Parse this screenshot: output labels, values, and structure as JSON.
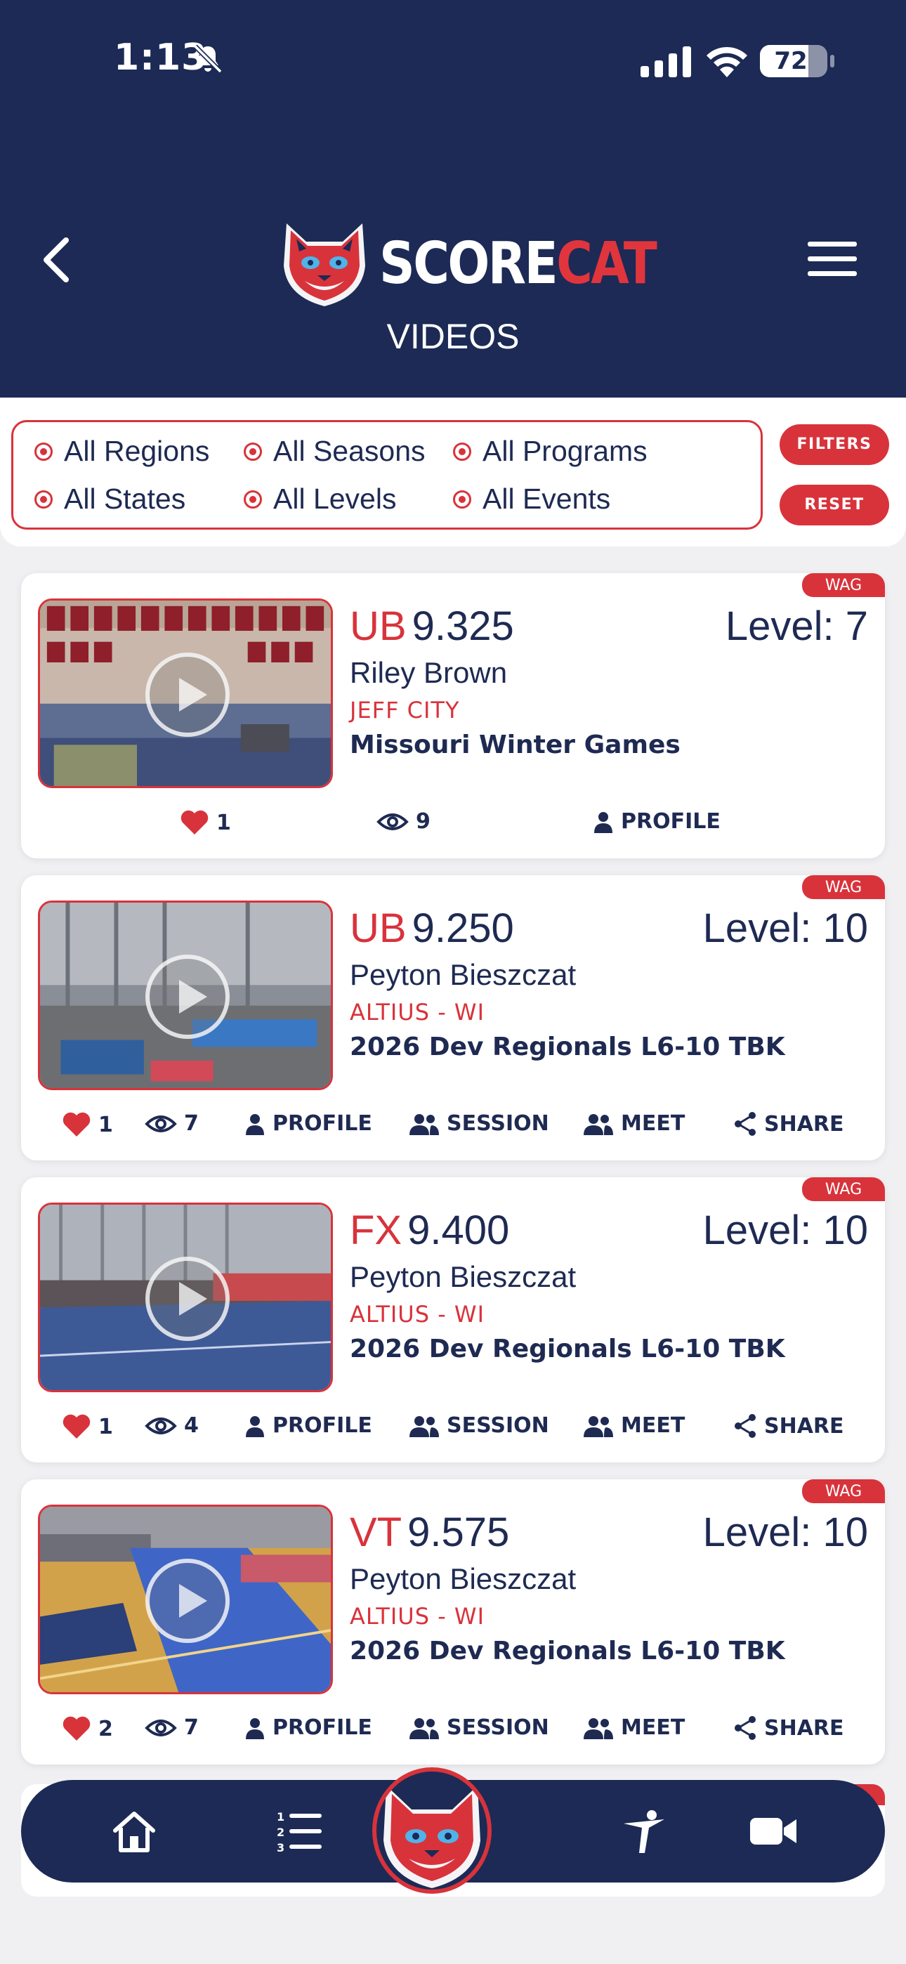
{
  "status_bar": {
    "time": "1:13",
    "battery": "72",
    "battery_level": 0.72
  },
  "header": {
    "logo_word_1": "SCORE",
    "logo_word_2": "CAT",
    "title": "VIDEOS"
  },
  "filters": {
    "items": [
      "All Regions",
      "All Seasons",
      "All Programs",
      "All States",
      "All Levels",
      "All Events"
    ],
    "filters_label": "FILTERS",
    "reset_label": "RESET"
  },
  "cards": [
    {
      "badge": "WAG",
      "event": "UB",
      "score": "9.325",
      "level": "Level: 7",
      "gymnast": "Riley Brown",
      "club": "JEFF CITY",
      "meet": "Missouri Winter Games",
      "likes": "1",
      "views": "9",
      "profile_label": "PROFILE"
    },
    {
      "badge": "WAG",
      "event": "UB",
      "score": "9.250",
      "level": "Level: 10",
      "gymnast": "Peyton Bieszczat",
      "club": "ALTIUS - WI",
      "meet": "2026 Dev Regionals L6-10 TBK",
      "likes": "1",
      "views": "7",
      "profile_label": "PROFILE",
      "session_label": "SESSION",
      "meet_label": "MEET",
      "share_label": "SHARE"
    },
    {
      "badge": "WAG",
      "event": "FX",
      "score": "9.400",
      "level": "Level: 10",
      "gymnast": "Peyton Bieszczat",
      "club": "ALTIUS - WI",
      "meet": "2026 Dev Regionals L6-10 TBK",
      "likes": "1",
      "views": "4",
      "profile_label": "PROFILE",
      "session_label": "SESSION",
      "meet_label": "MEET",
      "share_label": "SHARE"
    },
    {
      "badge": "WAG",
      "event": "VT",
      "score": "9.575",
      "level": "Level: 10",
      "gymnast": "Peyton Bieszczat",
      "club": "ALTIUS - WI",
      "meet": "2026 Dev Regionals L6-10 TBK",
      "likes": "2",
      "views": "7",
      "profile_label": "PROFILE",
      "session_label": "SESSION",
      "meet_label": "MEET",
      "share_label": "SHARE"
    }
  ],
  "bottom_nav": {
    "items": [
      "home-icon",
      "ranked-list-icon",
      "scorecat-logo-icon",
      "gymnast-icon",
      "video-camera-icon"
    ]
  },
  "colors": {
    "navy": "#1c2a55",
    "accent_red": "#d8333b",
    "text_navy": "#1e2a52",
    "background": "#f0f0f2"
  }
}
